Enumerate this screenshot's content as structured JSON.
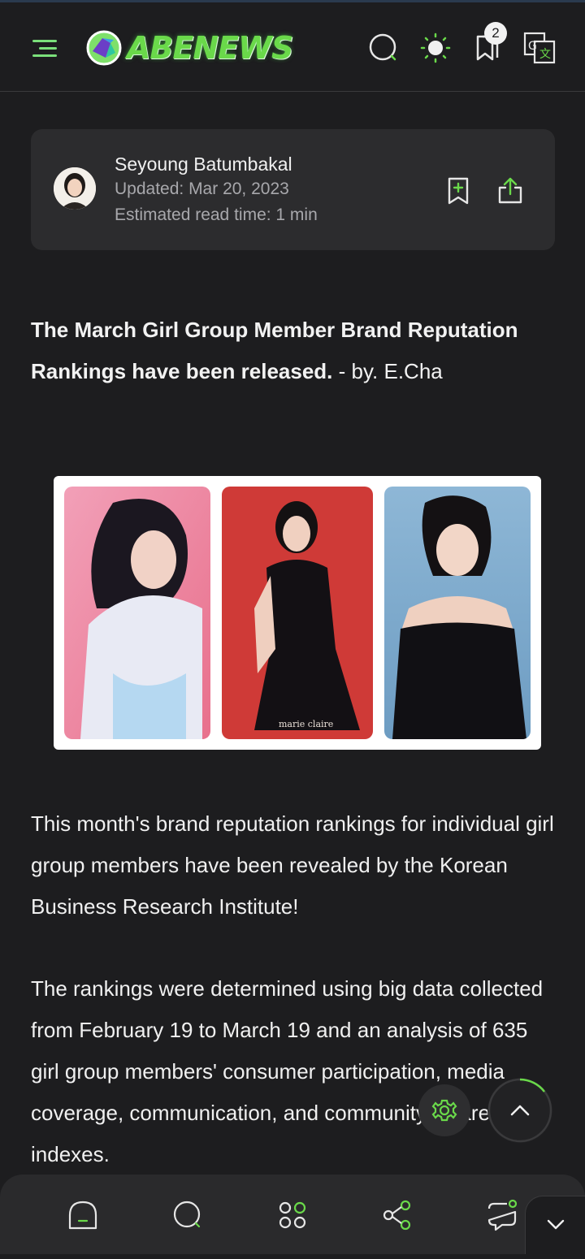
{
  "header": {
    "logo_text": "ABENEWS",
    "notification_count": "2",
    "icons": [
      "hamburger-menu-icon",
      "search-icon",
      "theme-toggle-icon",
      "bookmarks-icon",
      "translate-icon"
    ],
    "accent_color": "#6ad94a"
  },
  "author": {
    "name": "Seyoung Batumbakal",
    "updated": "Updated: Mar 20, 2023",
    "read_time": "Estimated read time: 1 min"
  },
  "article": {
    "headline_bold": "The March Girl Group Member Brand Reputation Rankings have been released.",
    "headline_byline": " - by. E.Cha",
    "paragraphs": [
      "This month's brand reputation rankings for individual girl group members have been revealed by the Korean Business Research Institute!",
      "The rankings were determined using big data collected from February 19 to March 19 and an analysis of 635 girl group members' consumer participation, media coverage, communication, and community awareness indexes."
    ],
    "image_watermark": "marie claire"
  },
  "bottom_nav": {
    "items": [
      "home-icon",
      "search-icon",
      "apps-grid-icon",
      "share-icon",
      "comments-icon"
    ]
  },
  "colors": {
    "background": "#1d1d1f",
    "card": "#2c2c2e",
    "accent_green": "#6ad94a"
  }
}
